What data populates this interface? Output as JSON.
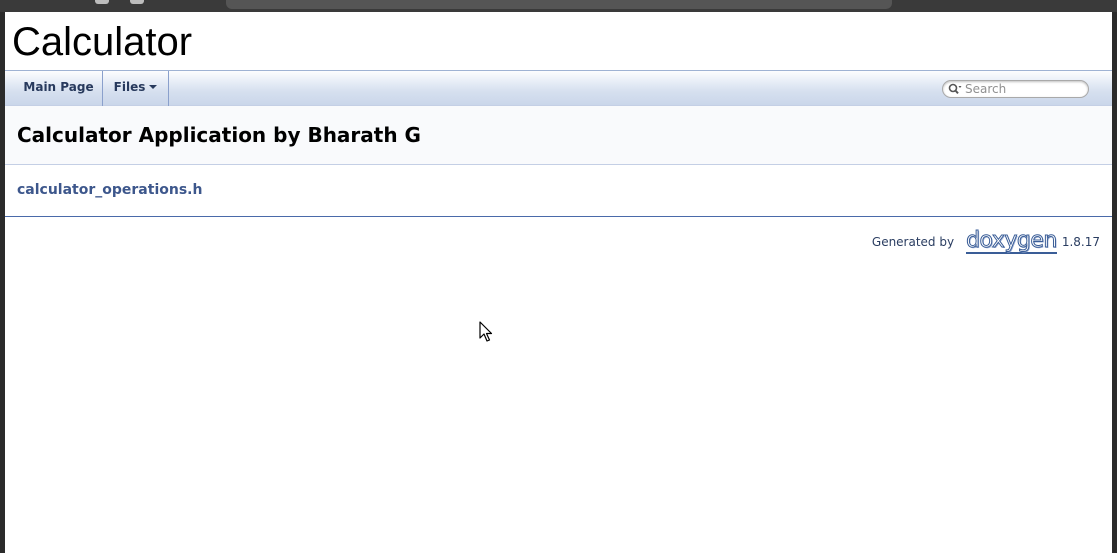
{
  "project": {
    "title": "Calculator"
  },
  "navbar": {
    "items": [
      {
        "label": "Main Page"
      },
      {
        "label": "Files"
      }
    ],
    "search": {
      "placeholder": "Search",
      "value": ""
    }
  },
  "header": {
    "title": "Calculator Application by Bharath G"
  },
  "contents": {
    "files": [
      {
        "name": "calculator_operations.h"
      }
    ]
  },
  "footer": {
    "generated_by": "Generated by",
    "logo_text": "doxygen",
    "version": "1.8.17"
  },
  "colors": {
    "link": "#3d578c",
    "nav_text": "#283a5d",
    "footer_rule": "#4a6aaa"
  }
}
